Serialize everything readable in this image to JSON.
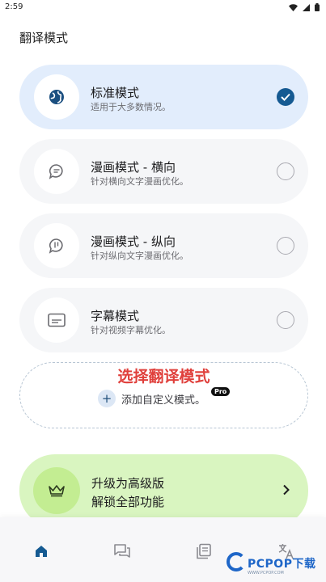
{
  "status_bar": {
    "time": "2:59"
  },
  "page": {
    "title": "翻译模式"
  },
  "modes": [
    {
      "title": "标准模式",
      "description": "适用于大多数情况。",
      "icon": "globe-icon",
      "selected": true
    },
    {
      "title": "漫画模式 - 横向",
      "description": "针对横向文字漫画优化。",
      "icon": "chat-bubble-icon",
      "selected": false
    },
    {
      "title": "漫画模式 - 纵向",
      "description": "针对纵向文字漫画优化。",
      "icon": "vertical-text-icon",
      "selected": false
    },
    {
      "title": "字幕模式",
      "description": "针对视频字幕优化。",
      "icon": "subtitles-icon",
      "selected": false
    }
  ],
  "add_custom": {
    "heading": "选择翻译模式",
    "label": "添加自定义模式。",
    "badge": "Pro"
  },
  "upgrade": {
    "title": "升级为高级版",
    "subtitle": "解锁全部功能"
  },
  "bottom_nav": [
    {
      "name": "home",
      "icon": "home-icon",
      "active": true
    },
    {
      "name": "chat",
      "icon": "chat-icon",
      "active": false
    },
    {
      "name": "document",
      "icon": "document-icon",
      "active": false
    },
    {
      "name": "translate",
      "icon": "translate-icon",
      "active": false
    }
  ],
  "watermark": {
    "brand": "PCPOP下载",
    "sub": "WWW.PCPOP.COM"
  },
  "colors": {
    "accent": "#155a92",
    "selected_card": "#e2edfc",
    "card": "#f5f6f8",
    "upgrade_card": "#d9f5c0",
    "heading_red": "#e0403c"
  }
}
